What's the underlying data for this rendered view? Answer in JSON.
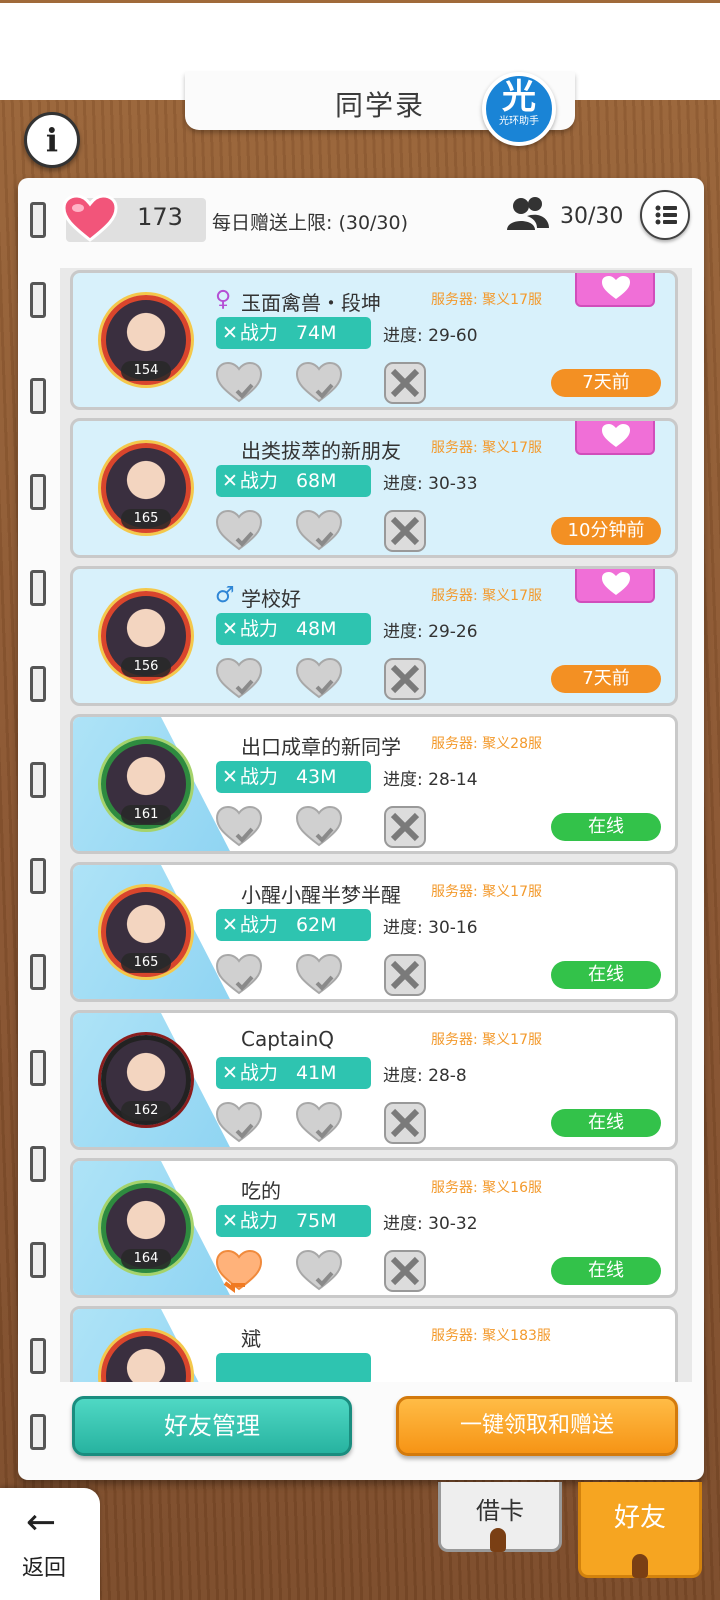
{
  "header": {
    "title": "同学录",
    "logo_char": "光",
    "logo_sub": "光环助手",
    "info_icon": "i"
  },
  "stats": {
    "hearts": "173",
    "daily_limit": "每日赠送上限: (30/30)",
    "friends_count": "30/30"
  },
  "friends": [
    {
      "gender": "♀",
      "name": "玉面禽兽・段坤",
      "server": "服务器: 聚义17服",
      "power_label": "战力",
      "power": "74M",
      "progress": "进度: 29-60",
      "level": "154",
      "status": "7天前",
      "gift": "11"
    },
    {
      "gender": "",
      "name": "出类拔萃的新朋友",
      "server": "服务器: 聚义17服",
      "power_label": "战力",
      "power": "68M",
      "progress": "进度: 30-33",
      "level": "165",
      "status": "10分钟前",
      "gift": "10"
    },
    {
      "gender": "♂",
      "name": "学校好",
      "server": "服务器: 聚义17服",
      "power_label": "战力",
      "power": "48M",
      "progress": "进度: 29-26",
      "level": "156",
      "status": "7天前",
      "gift": "10"
    },
    {
      "gender": "",
      "name": "出口成章的新同学",
      "server": "服务器: 聚义28服",
      "power_label": "战力",
      "power": "43M",
      "progress": "进度: 28-14",
      "level": "161",
      "status": "在线"
    },
    {
      "gender": "",
      "name": "小醒小醒半梦半醒",
      "server": "服务器: 聚义17服",
      "power_label": "战力",
      "power": "62M",
      "progress": "进度: 30-16",
      "level": "165",
      "status": "在线"
    },
    {
      "gender": "",
      "name": "CaptainQ",
      "server": "服务器: 聚义17服",
      "power_label": "战力",
      "power": "41M",
      "progress": "进度: 28-8",
      "level": "162",
      "status": "在线"
    },
    {
      "gender": "",
      "name": "吃的",
      "server": "服务器: 聚义16服",
      "power_label": "战力",
      "power": "75M",
      "progress": "进度: 30-32",
      "level": "164",
      "status": "在线"
    },
    {
      "gender": "",
      "name": "斌",
      "server": "服务器: 聚义183服",
      "power_label": "",
      "power": "",
      "progress": "",
      "level": "",
      "status": ""
    }
  ],
  "buttons": {
    "manage": "好友管理",
    "collect": "一键领取和赠送"
  },
  "nav": {
    "back_label": "返回",
    "back_arrow": "←",
    "tab_borrow": "借卡",
    "tab_friends": "好友"
  },
  "colors": {
    "teal": "#2ec4b0",
    "orange": "#f39023",
    "online": "#33c24a",
    "server_text": "#f39a2d",
    "gift_pink": "#f06fd7"
  }
}
